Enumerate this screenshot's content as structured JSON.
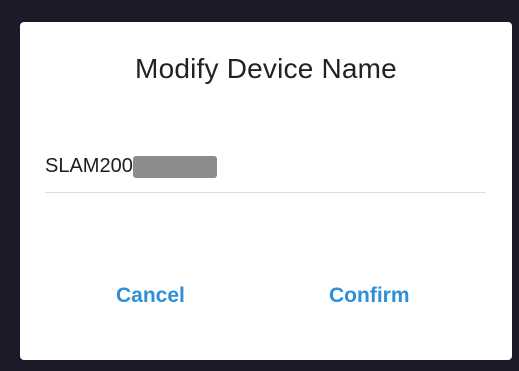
{
  "dialog": {
    "title": "Modify Device Name",
    "device_name_prefix": "SLAM200",
    "cancel_label": "Cancel",
    "confirm_label": "Confirm"
  },
  "colors": {
    "accent": "#2F8FD8",
    "overlay": "#1A1A28",
    "redaction": "#8C8C8C"
  }
}
